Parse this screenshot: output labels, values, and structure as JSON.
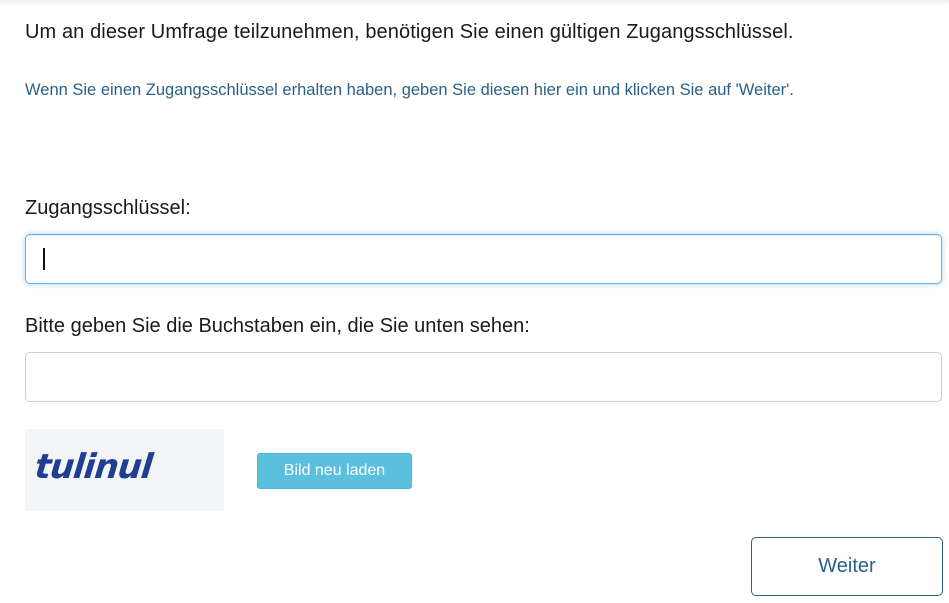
{
  "heading": "Um an dieser Umfrage teilzunehmen, benötigen Sie einen gültigen Zugangsschlüssel.",
  "info_text": "Wenn Sie einen Zugangsschlüssel erhalten haben, geben Sie diesen hier ein und klicken Sie auf 'Weiter'.",
  "access_key": {
    "label": "Zugangsschlüssel:",
    "value": ""
  },
  "captcha": {
    "label": "Bitte geben Sie die Buchstaben ein, die Sie unten sehen:",
    "value": "",
    "image_text": "tulinul",
    "image_text_color": "#1f3f93",
    "reload_label": "Bild neu laden"
  },
  "next_label": "Weiter",
  "colors": {
    "text": "#1a1a1a",
    "info": "#2a5f8a",
    "focus_border": "#66afe9",
    "reload_button": "#5bc0de"
  }
}
